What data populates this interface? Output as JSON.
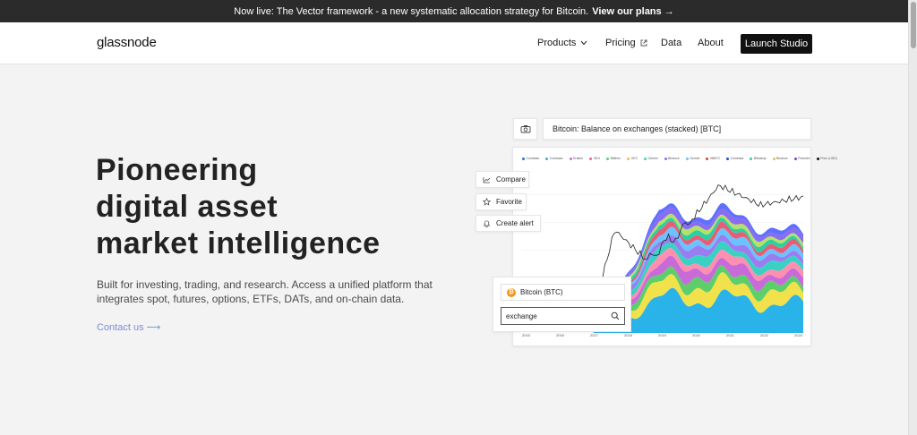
{
  "banner": {
    "text": "Now live: The Vector framework - a new systematic allocation strategy for Bitcoin.",
    "link": "View our plans →"
  },
  "nav": {
    "logo": "glassnode",
    "products": "Products",
    "pricing": "Pricing",
    "data": "Data",
    "about": "About",
    "launch": "Launch Studio"
  },
  "hero": {
    "headline": [
      "Pioneering",
      "digital asset",
      "market intelligence"
    ],
    "subtitle": "Built for investing, trading, and research. Access a unified platform that integrates spot, futures, options, ETFs, DATs, and on-chain data.",
    "contact": "Contact us",
    "contact_arrow": "⟶"
  },
  "widget": {
    "chart_title": "Bitcoin: Balance on exchanges (stacked) [BTC]",
    "actions": [
      "Compare",
      "Favorite",
      "Create alert"
    ],
    "asset": "Bitcoin (BTC)",
    "search_value": "exchange",
    "legend": [
      {
        "name": "Coinbase",
        "color": "#1f77d4"
      },
      {
        "name": "Coinbase",
        "color": "#2ab3e8"
      },
      {
        "name": "Kraken",
        "color": "#c86bd8"
      },
      {
        "name": "OKX",
        "color": "#ff5b8a"
      },
      {
        "name": "Bitfinex",
        "color": "#5ccf6b"
      },
      {
        "name": "OKX",
        "color": "#ffb347"
      },
      {
        "name": "Gemini",
        "color": "#3bd0c4"
      },
      {
        "name": "Binance",
        "color": "#8a6cf0"
      },
      {
        "name": "Gemini",
        "color": "#6cc1ff"
      },
      {
        "name": "HitBTC",
        "color": "#e23b3b"
      },
      {
        "name": "Coinbase",
        "color": "#1b4fd1"
      },
      {
        "name": "Bitstamp",
        "color": "#2ad1a0"
      },
      {
        "name": "Binance",
        "color": "#e8c23a"
      },
      {
        "name": "Poloniex",
        "color": "#7a3cd1"
      },
      {
        "name": "Price (USD)",
        "color": "#111111"
      }
    ],
    "xticks": [
      "2015",
      "2016",
      "2017",
      "2018",
      "2019",
      "2020",
      "2021",
      "2022",
      "2023"
    ]
  },
  "chart_data": {
    "type": "area",
    "title": "Bitcoin: Balance on exchanges (stacked) [BTC]",
    "x": [
      "2015",
      "2016",
      "2017",
      "2018",
      "2019",
      "2020",
      "2021",
      "2022",
      "2023"
    ],
    "series": [
      {
        "name": "Coinbase",
        "values": [
          0,
          0,
          0.05,
          0.2,
          0.3,
          0.35,
          0.36,
          0.3,
          0.26
        ]
      },
      {
        "name": "Binance",
        "values": [
          0,
          0,
          0.03,
          0.1,
          0.14,
          0.17,
          0.17,
          0.15,
          0.14
        ]
      },
      {
        "name": "Bitfinex",
        "values": [
          0,
          0,
          0.03,
          0.08,
          0.1,
          0.11,
          0.1,
          0.09,
          0.09
        ]
      },
      {
        "name": "Kraken",
        "values": [
          0,
          0,
          0.02,
          0.07,
          0.09,
          0.1,
          0.1,
          0.09,
          0.09
        ]
      },
      {
        "name": "OKX",
        "values": [
          0,
          0,
          0.02,
          0.07,
          0.09,
          0.1,
          0.09,
          0.08,
          0.08
        ]
      },
      {
        "name": "Gemini",
        "values": [
          0,
          0,
          0.02,
          0.06,
          0.07,
          0.08,
          0.08,
          0.07,
          0.07
        ]
      },
      {
        "name": "Poloniex",
        "values": [
          0,
          0,
          0.02,
          0.06,
          0.07,
          0.08,
          0.08,
          0.06,
          0.06
        ]
      }
    ],
    "price_line": [
      0.02,
      0.05,
      0.25,
      0.4,
      0.35,
      0.5,
      0.95,
      0.7,
      0.82
    ]
  }
}
